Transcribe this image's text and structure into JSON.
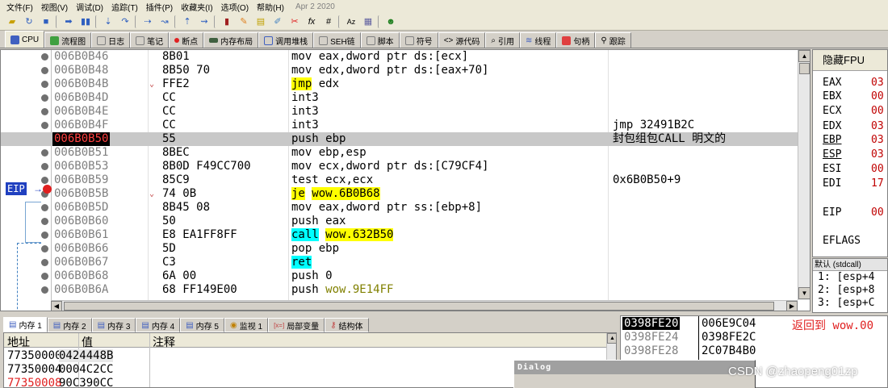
{
  "menu": [
    "文件(F)",
    "视图(V)",
    "调试(D)",
    "追踪(T)",
    "插件(P)",
    "收藏夹(I)",
    "选项(O)",
    "帮助(H)"
  ],
  "menu_date": "Apr 2 2020",
  "toolbar_icons": [
    "open-icon",
    "restart-icon",
    "stop-icon",
    "run-icon",
    "pause-icon",
    "step-into-icon",
    "step-over-icon",
    "trace-into-icon",
    "trace-over-icon",
    "execute-till-return-icon",
    "run-to-user-code-icon",
    "breakpoint-icon",
    "edit-icon",
    "patch-icon",
    "comment-icon",
    "hide-icon",
    "function-icon",
    "symbol-icon",
    "font-icon",
    "calculator-icon",
    "about-icon"
  ],
  "tabs": [
    {
      "label": "CPU",
      "icon": "cpu-icon",
      "color": "#4060c0"
    },
    {
      "label": "流程图",
      "icon": "graph-icon",
      "color": "#40a040"
    },
    {
      "label": "日志",
      "icon": "log-icon",
      "color": "#808080"
    },
    {
      "label": "笔记",
      "icon": "notes-icon",
      "color": "#808080"
    },
    {
      "label": "断点",
      "icon": "breakpoint-icon",
      "color": "#e02020"
    },
    {
      "label": "内存布局",
      "icon": "memory-map-icon",
      "color": "#406040"
    },
    {
      "label": "调用堆栈",
      "icon": "callstack-icon",
      "color": "#4060c0"
    },
    {
      "label": "SEH链",
      "icon": "seh-icon",
      "color": "#808080"
    },
    {
      "label": "脚本",
      "icon": "script-icon",
      "color": "#808080"
    },
    {
      "label": "符号",
      "icon": "symbols-icon",
      "color": "#808080"
    },
    {
      "label": "源代码",
      "icon": "source-icon",
      "color": "#808080"
    },
    {
      "label": "引用",
      "icon": "references-icon",
      "color": "#808080"
    },
    {
      "label": "线程",
      "icon": "threads-icon",
      "color": "#4060c0"
    },
    {
      "label": "句柄",
      "icon": "handles-icon",
      "color": "#e04040"
    },
    {
      "label": "跟踪",
      "icon": "trace-icon",
      "color": "#808080"
    }
  ],
  "disasm": [
    {
      "addr": "006B0B46",
      "bytes": "8B01",
      "mark": "",
      "ins": "mov",
      "ops": "eax,dword ptr ds:[ecx]",
      "cmt": ""
    },
    {
      "addr": "006B0B48",
      "bytes": "8B50 70",
      "mark": "",
      "ins": "mov",
      "ops": "edx,dword ptr ds:[eax+70]",
      "cmt": ""
    },
    {
      "addr": "006B0B4B",
      "bytes": "FFE2",
      "mark": "⌄",
      "ins": "jmp",
      "ops": "edx",
      "cmt": ""
    },
    {
      "addr": "006B0B4D",
      "bytes": "CC",
      "mark": "",
      "ins": "int3",
      "ops": "",
      "cmt": ""
    },
    {
      "addr": "006B0B4E",
      "bytes": "CC",
      "mark": "",
      "ins": "int3",
      "ops": "",
      "cmt": ""
    },
    {
      "addr": "006B0B4F",
      "bytes": "CC",
      "mark": "",
      "ins": "int3",
      "ops": "",
      "cmt": "jmp 32491B2C"
    },
    {
      "addr": "006B0B50",
      "bytes": "55",
      "mark": "",
      "ins": "push",
      "ops": "ebp",
      "cmt": "封包组包CALL 明文的"
    },
    {
      "addr": "006B0B51",
      "bytes": "8BEC",
      "mark": "",
      "ins": "mov",
      "ops": "ebp,esp",
      "cmt": ""
    },
    {
      "addr": "006B0B53",
      "bytes": "8B0D F49CC700",
      "mark": "",
      "ins": "mov",
      "ops": "ecx,dword ptr ds:[C79CF4]",
      "cmt": ""
    },
    {
      "addr": "006B0B59",
      "bytes": "85C9",
      "mark": "",
      "ins": "test",
      "ops": "ecx,ecx",
      "cmt": "0x6B0B50+9"
    },
    {
      "addr": "006B0B5B",
      "bytes": "74 0B",
      "mark": "⌄",
      "ins": "je",
      "ops": "wow.6B0B68",
      "cmt": ""
    },
    {
      "addr": "006B0B5D",
      "bytes": "8B45 08",
      "mark": "",
      "ins": "mov",
      "ops": "eax,dword ptr ss:[ebp+8]",
      "cmt": ""
    },
    {
      "addr": "006B0B60",
      "bytes": "50",
      "mark": "",
      "ins": "push",
      "ops": "eax",
      "cmt": ""
    },
    {
      "addr": "006B0B61",
      "bytes": "E8 EA1FF8FF",
      "mark": "",
      "ins": "call",
      "ops": "wow.632B50",
      "cmt": ""
    },
    {
      "addr": "006B0B66",
      "bytes": "5D",
      "mark": "",
      "ins": "pop",
      "ops": "ebp",
      "cmt": ""
    },
    {
      "addr": "006B0B67",
      "bytes": "C3",
      "mark": "",
      "ins": "ret",
      "ops": "",
      "cmt": ""
    },
    {
      "addr": "006B0B68",
      "bytes": "6A 00",
      "mark": "",
      "ins": "push",
      "ops": "0",
      "cmt": ""
    },
    {
      "addr": "006B0B6A",
      "bytes": "68 FF149E00",
      "mark": "",
      "ins": "push",
      "ops": "wow.9E14FF",
      "cmt": ""
    }
  ],
  "eip_label": "EIP",
  "eip_arrow": "→",
  "registers": {
    "title": "隐藏FPU",
    "items": [
      {
        "name": "EAX",
        "val": "03"
      },
      {
        "name": "EBX",
        "val": "00"
      },
      {
        "name": "ECX",
        "val": "00"
      },
      {
        "name": "EDX",
        "val": "03"
      },
      {
        "name": "EBP",
        "val": "03"
      },
      {
        "name": "ESP",
        "val": "03"
      },
      {
        "name": "ESI",
        "val": "00"
      },
      {
        "name": "EDI",
        "val": "17"
      },
      {
        "name": "EIP",
        "val": "00"
      },
      {
        "name": "EFLAGS",
        "val": ""
      }
    ]
  },
  "callconv": {
    "header": "默认 (stdcall)",
    "lines": [
      "1: [esp+4",
      "2: [esp+8",
      "3: [esp+C"
    ]
  },
  "mem_tabs": [
    {
      "label": "内存 1",
      "icon": "memory-icon"
    },
    {
      "label": "内存 2",
      "icon": "memory-icon"
    },
    {
      "label": "内存 3",
      "icon": "memory-icon"
    },
    {
      "label": "内存 4",
      "icon": "memory-icon"
    },
    {
      "label": "内存 5",
      "icon": "memory-icon"
    },
    {
      "label": "监视 1",
      "icon": "watch-icon"
    },
    {
      "label": "局部变量",
      "icon": "locals-icon"
    },
    {
      "label": "结构体",
      "icon": "struct-icon"
    }
  ],
  "dump": {
    "headers": {
      "addr": "地址",
      "val": "值",
      "cmt": "注释"
    },
    "rows": [
      {
        "addr": "77350000",
        "val": "0424448B"
      },
      {
        "addr": "77350004",
        "val": "0004C2CC"
      },
      {
        "addr": "77350008",
        "val": "90C390CC"
      }
    ]
  },
  "stack": [
    {
      "addr": "0398FE20",
      "val": "006E9C04",
      "cmt": "返回到 wow.00"
    },
    {
      "addr": "0398FE24",
      "val": "0398FE2C",
      "cmt": ""
    },
    {
      "addr": "0398FE28",
      "val": "2C07B4B0",
      "cmt": ""
    }
  ],
  "dialog_title": "Dialog",
  "watermark": "CSDN @zhaopeng01zp",
  "colors": {
    "eip_tag": "#2040c0",
    "breakpoint": "#e02020",
    "jump_highlight": "#ffff00",
    "call_highlight": "#00ffff"
  }
}
